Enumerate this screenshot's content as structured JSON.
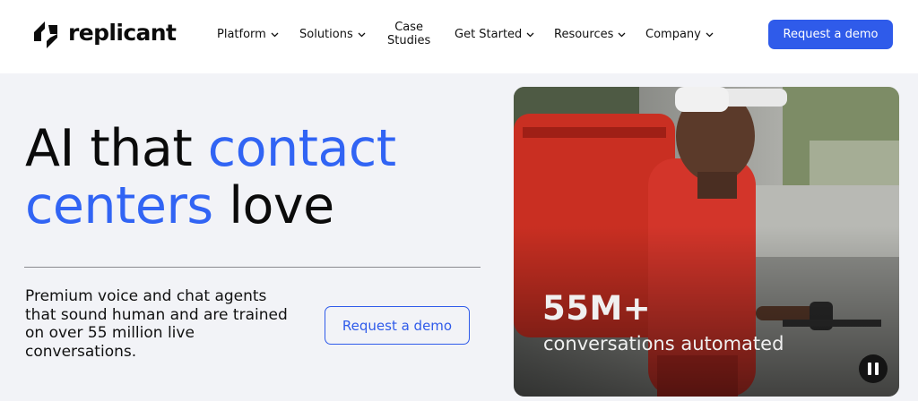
{
  "brand": {
    "name": "replicant"
  },
  "nav": {
    "items": [
      {
        "label": "Platform"
      },
      {
        "label": "Solutions"
      },
      {
        "label_line1": "Case",
        "label_line2": "Studies"
      },
      {
        "label": "Get Started"
      },
      {
        "label": "Resources"
      },
      {
        "label": "Company"
      }
    ],
    "cta_label": "Request a demo"
  },
  "hero": {
    "headline_part1": "AI that ",
    "headline_highlight1": "contact",
    "headline_highlight2": "centers",
    "headline_part2": " love",
    "subtitle": "Premium voice and chat agents that sound human and are trained on over 55 million live conversations.",
    "cta_label": "Request a demo"
  },
  "media": {
    "stat_value": "55M+",
    "stat_label": "conversations automated"
  },
  "colors": {
    "accent": "#2f5bea",
    "headline_blue": "#3164f4",
    "background": "#f2f3f7"
  },
  "icons": {
    "chevron": "chevron-down-icon",
    "pause": "pause-icon",
    "logo": "replicant-logo-icon"
  }
}
